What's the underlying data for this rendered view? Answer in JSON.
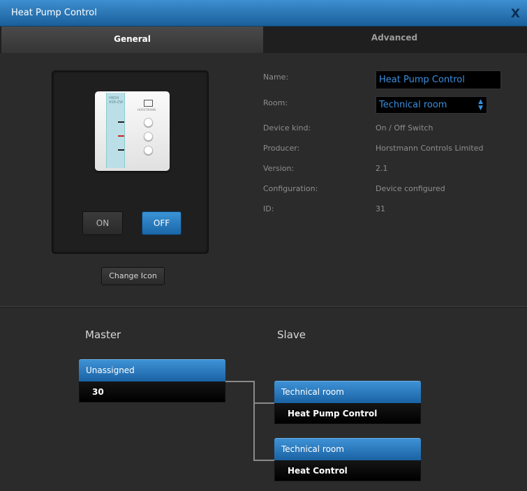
{
  "window": {
    "title": "Heat Pump Control",
    "close_label": "X"
  },
  "tabs": [
    {
      "label": "General"
    },
    {
      "label": "Advanced"
    }
  ],
  "device": {
    "strip_text": "HRD4\nASR-ZW",
    "brand": "HORSTMANN",
    "on_label": "ON",
    "off_label": "OFF",
    "change_icon_label": "Change Icon"
  },
  "properties": {
    "name_label": "Name:",
    "name_value": "Heat Pump Control",
    "room_label": "Room:",
    "room_value": "Technical room",
    "kind_label": "Device kind:",
    "kind_value": "On / Off Switch",
    "producer_label": "Producer:",
    "producer_value": "Horstmann Controls Limited",
    "version_label": "Version:",
    "version_value": "2.1",
    "config_label": "Configuration:",
    "config_value": "Device configured",
    "id_label": "ID:",
    "id_value": "31"
  },
  "association": {
    "master_heading": "Master",
    "slave_heading": "Slave",
    "master": {
      "group": "Unassigned",
      "item": "30"
    },
    "slaves": [
      {
        "group": "Technical room",
        "item": "Heat Pump Control"
      },
      {
        "group": "Technical room",
        "item": "Heat Control"
      }
    ]
  },
  "colors": {
    "accent": "#1f6fb5",
    "input_text": "#3b8fde",
    "background": "#2b2b2b"
  },
  "icons": {
    "close": "close-icon",
    "select_arrow": "updown-arrow-icon"
  }
}
